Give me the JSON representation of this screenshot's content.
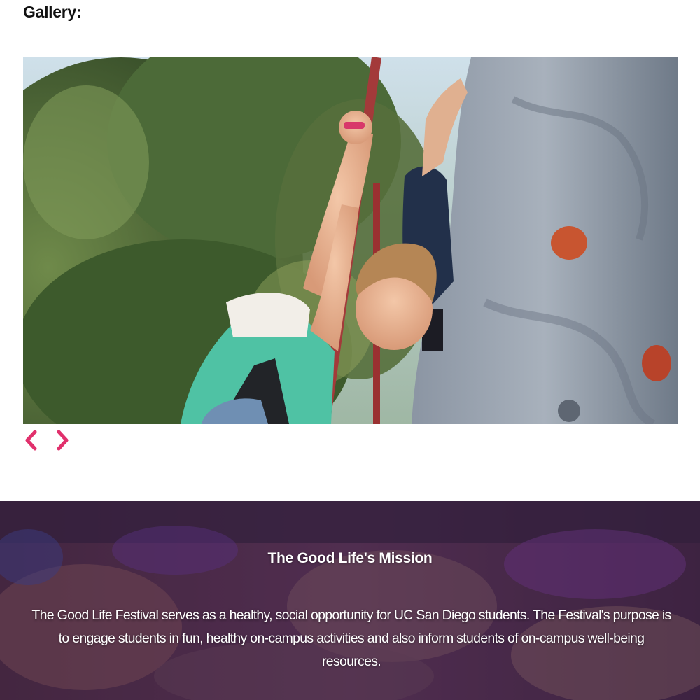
{
  "gallery": {
    "heading": "Gallery:",
    "slide_image": "rock-climbing-wall-photo",
    "nav": {
      "prev_icon": "chevron-left-icon",
      "next_icon": "chevron-right-icon"
    }
  },
  "mission": {
    "title": "The Good Life's Mission",
    "body": "The Good Life Festival serves as a healthy, social opportunity for UC San Diego students. The Festival's purpose is to engage students in fun, healthy on-campus activities and also inform students of on-campus well-being resources."
  },
  "colors": {
    "accent": "#e1306c",
    "mission_overlay": "#5a2a6e"
  }
}
